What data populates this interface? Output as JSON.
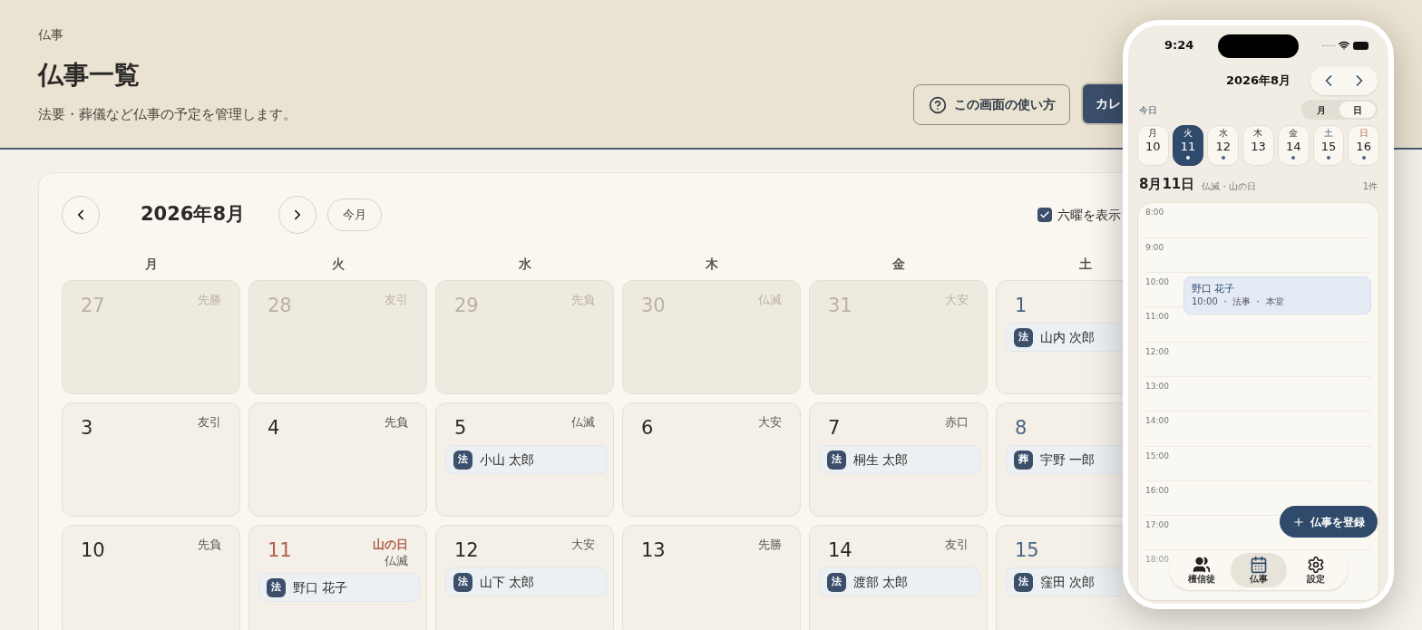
{
  "header": {
    "breadcrumb": "仏事",
    "title": "仏事一覧",
    "subtitle": "法要・葬儀など仏事の予定を管理します。",
    "help_button": "この画面の使い方",
    "calendar_button": "カレ"
  },
  "calendar": {
    "month": "2026年8月",
    "today_button": "今月",
    "rokuyo_toggle": {
      "label": "六曜を表示",
      "checked": true
    },
    "weekdays": [
      {
        "label": "月"
      },
      {
        "label": "火"
      },
      {
        "label": "水"
      },
      {
        "label": "木"
      },
      {
        "label": "金"
      },
      {
        "label": "土"
      }
    ],
    "weeks": [
      [
        {
          "day": "27",
          "rokuyo": "先勝",
          "kind": "outside"
        },
        {
          "day": "28",
          "rokuyo": "友引",
          "kind": "outside"
        },
        {
          "day": "29",
          "rokuyo": "先負",
          "kind": "outside"
        },
        {
          "day": "30",
          "rokuyo": "仏滅",
          "kind": "outside"
        },
        {
          "day": "31",
          "rokuyo": "大安",
          "kind": "outside"
        },
        {
          "day": "1",
          "kind": "saturday",
          "events": [
            {
              "badge": "法",
              "name": "山内 次郎"
            }
          ]
        }
      ],
      [
        {
          "day": "3",
          "rokuyo": "友引",
          "kind": "weekday"
        },
        {
          "day": "4",
          "rokuyo": "先負",
          "kind": "weekday"
        },
        {
          "day": "5",
          "rokuyo": "仏滅",
          "kind": "weekday",
          "events": [
            {
              "badge": "法",
              "name": "小山 太郎"
            }
          ]
        },
        {
          "day": "6",
          "rokuyo": "大安",
          "kind": "weekday"
        },
        {
          "day": "7",
          "rokuyo": "赤口",
          "kind": "weekday",
          "events": [
            {
              "badge": "法",
              "name": "桐生 太郎"
            }
          ]
        },
        {
          "day": "8",
          "kind": "saturday",
          "events": [
            {
              "badge": "葬",
              "name": "宇野 一郎"
            }
          ]
        }
      ],
      [
        {
          "day": "10",
          "rokuyo": "先負",
          "kind": "weekday"
        },
        {
          "day": "11",
          "holiday": "山の日",
          "rokuyo": "仏滅",
          "kind": "holiday",
          "events": [
            {
              "badge": "法",
              "name": "野口 花子"
            }
          ]
        },
        {
          "day": "12",
          "rokuyo": "大安",
          "kind": "weekday",
          "events": [
            {
              "badge": "法",
              "name": "山下 太郎"
            }
          ]
        },
        {
          "day": "13",
          "rokuyo": "先勝",
          "kind": "weekday"
        },
        {
          "day": "14",
          "rokuyo": "友引",
          "kind": "weekday",
          "events": [
            {
              "badge": "法",
              "name": "渡部 太郎"
            }
          ]
        },
        {
          "day": "15",
          "kind": "saturday",
          "events": [
            {
              "badge": "法",
              "name": "窪田 次郎"
            }
          ]
        }
      ]
    ]
  },
  "phone": {
    "time": "9:24",
    "month": "2026年8月",
    "today_link": "今日",
    "view_toggle": [
      {
        "label": "月",
        "selected": false
      },
      {
        "label": "日",
        "selected": true
      }
    ],
    "week": [
      {
        "weekday": "月",
        "day": "10",
        "kind": "weekday",
        "selected": false,
        "has_event": false
      },
      {
        "weekday": "火",
        "day": "11",
        "kind": "weekday",
        "selected": true,
        "has_event": true
      },
      {
        "weekday": "水",
        "day": "12",
        "kind": "weekday",
        "selected": false,
        "has_event": true
      },
      {
        "weekday": "木",
        "day": "13",
        "kind": "weekday",
        "selected": false,
        "has_event": false
      },
      {
        "weekday": "金",
        "day": "14",
        "kind": "weekday",
        "selected": false,
        "has_event": true
      },
      {
        "weekday": "土",
        "day": "15",
        "kind": "saturday",
        "selected": false,
        "has_event": true
      },
      {
        "weekday": "日",
        "day": "16",
        "kind": "sunday",
        "selected": false,
        "has_event": true
      }
    ],
    "date_title": "8月11日",
    "date_note": "仏滅・山の日",
    "count": "1件",
    "hours": [
      {
        "label": "8:00"
      },
      {
        "label": "9:00"
      },
      {
        "label": "10:00",
        "events": [
          {
            "name": "野口 花子",
            "detail": "10:00 ・ 法事 ・ 本堂"
          }
        ]
      },
      {
        "label": "11:00"
      },
      {
        "label": "12:00"
      },
      {
        "label": "13:00"
      },
      {
        "label": "14:00"
      },
      {
        "label": "15:00"
      },
      {
        "label": "16:00"
      },
      {
        "label": "17:00"
      },
      {
        "label": "18:00"
      }
    ],
    "add_button": "仏事を登録",
    "tabs": [
      {
        "label": "檀信徒",
        "selected": false
      },
      {
        "label": "仏事",
        "selected": true
      },
      {
        "label": "設定",
        "selected": false
      }
    ]
  }
}
